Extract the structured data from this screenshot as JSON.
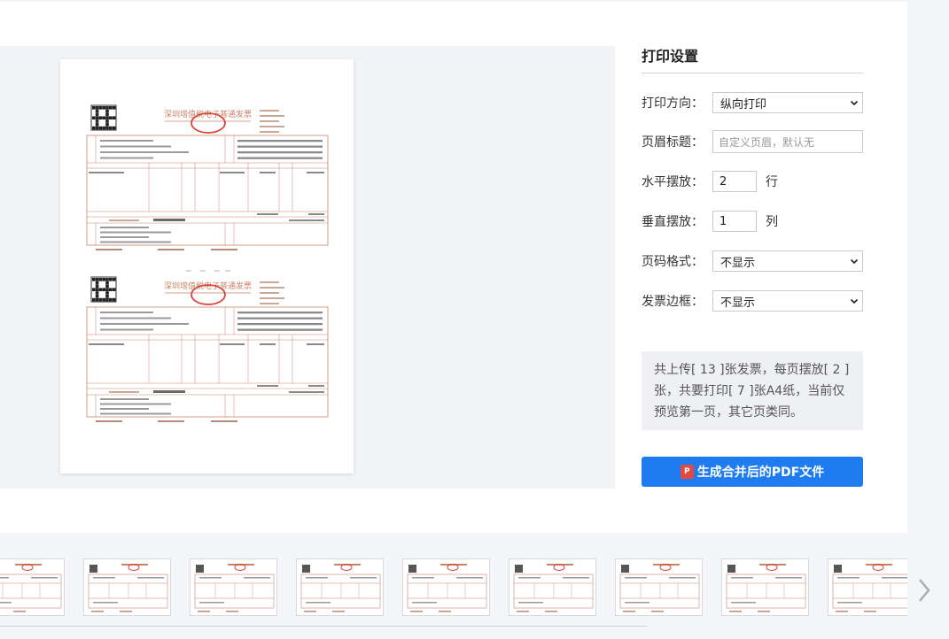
{
  "settings": {
    "title": "打印设置",
    "orientation": {
      "label": "打印方向：",
      "value": "纵向打印"
    },
    "header_title": {
      "label": "页眉标题：",
      "placeholder": "自定义页眉，默认无"
    },
    "horizontal": {
      "label": "水平摆放：",
      "value": "2",
      "unit": "行"
    },
    "vertical": {
      "label": "垂直摆放：",
      "value": "1",
      "unit": "列"
    },
    "page_number": {
      "label": "页码格式：",
      "value": "不显示"
    },
    "border": {
      "label": "发票边框：",
      "value": "不显示"
    }
  },
  "info": "共上传[ 13 ]张发票，每页摆放[ 2 ]张，共要打印[ 7 ]张A4纸，当前仅预览第一页，其它页类同。",
  "generate_button": {
    "label": "生成合并后的PDF文件",
    "icon": "pdf-icon"
  },
  "invoice": {
    "title": "深圳增值税电子普通发票",
    "seal_text": "发票监制章",
    "stamp_color": "#d9463a",
    "line_color": "#c9826a"
  },
  "thumbnails_count": 9,
  "colors": {
    "accent": "#1f7cf0",
    "panel_bg": "#ffffff",
    "page_bg": "#f3f5f8"
  }
}
